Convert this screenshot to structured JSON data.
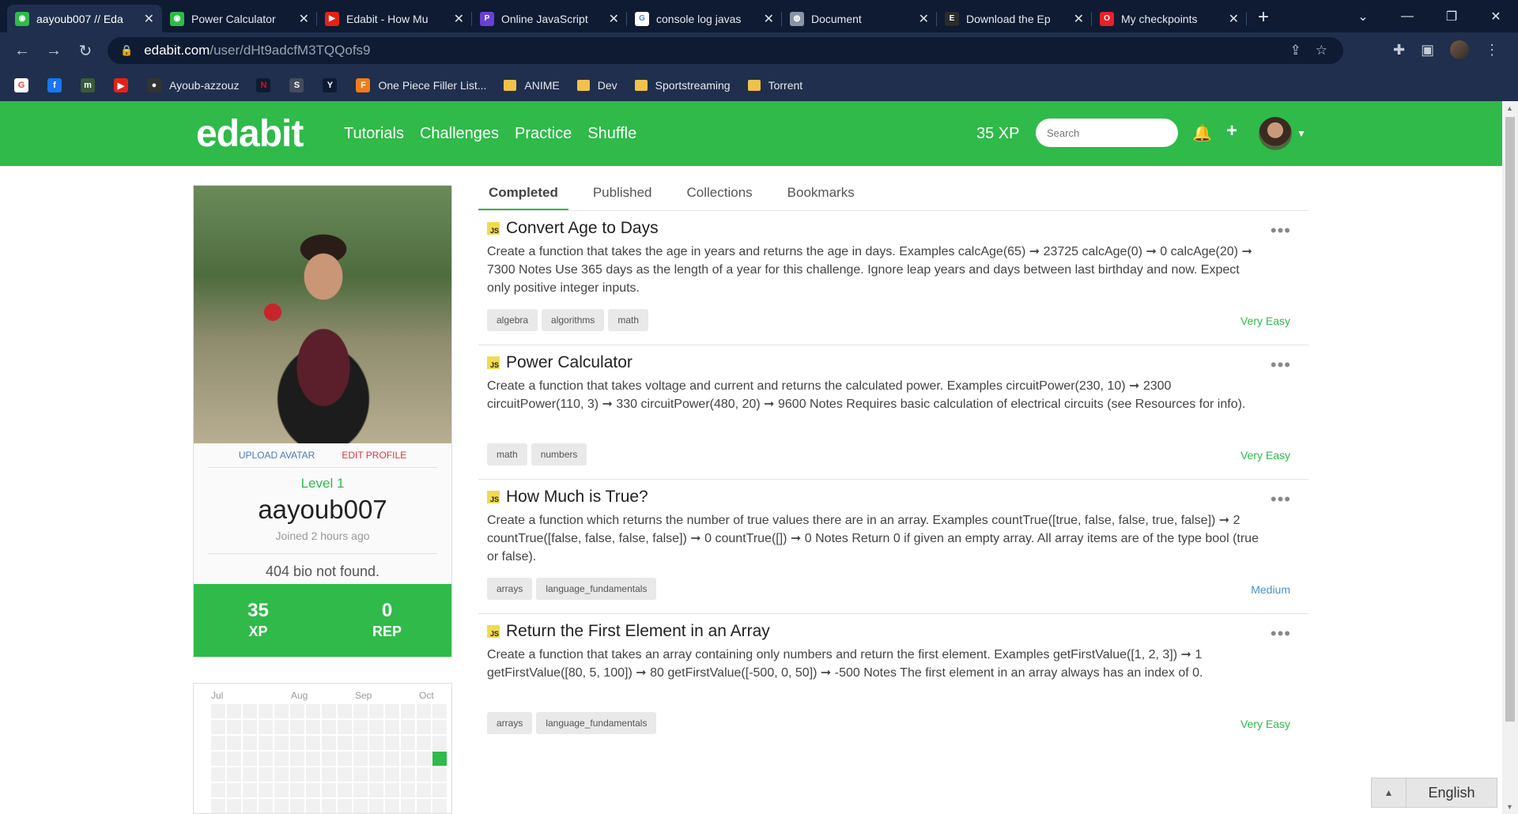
{
  "browser": {
    "tabs": [
      {
        "title": "aayoub007 // Eda",
        "icon": "edabit-favicon",
        "color": "#2fba4a",
        "glyph": "◉",
        "active": true
      },
      {
        "title": "Power Calculator",
        "icon": "edabit-favicon",
        "color": "#2fba4a",
        "glyph": "◉",
        "active": false
      },
      {
        "title": "Edabit - How Mu",
        "icon": "youtube-favicon",
        "color": "#e62117",
        "glyph": "▶",
        "active": false
      },
      {
        "title": "Online JavaScript",
        "icon": "playcode-favicon",
        "color": "#6b3fd8",
        "glyph": "P",
        "active": false
      },
      {
        "title": "console log javas",
        "icon": "google-favicon",
        "color": "#ffffff",
        "glyph": "G",
        "active": false
      },
      {
        "title": "Document",
        "icon": "globe-favicon",
        "color": "#8a94a6",
        "glyph": "◍",
        "active": false
      },
      {
        "title": "Download the Ep",
        "icon": "epic-favicon",
        "color": "#2b2b2b",
        "glyph": "E",
        "active": false
      },
      {
        "title": "My checkpoints",
        "icon": "opera-favicon",
        "color": "#e8202a",
        "glyph": "O",
        "active": false
      }
    ],
    "url_host": "edabit.com",
    "url_path": "/user/dHt9adcfM3TQQofs9",
    "bookmarks": [
      {
        "label": "",
        "icon": "google-icon",
        "color": "#ffffff",
        "glyph": "G"
      },
      {
        "label": "",
        "icon": "facebook-icon",
        "color": "#1877f2",
        "glyph": "f"
      },
      {
        "label": "",
        "icon": "extension-icon",
        "color": "#3a5a3a",
        "glyph": "m"
      },
      {
        "label": "",
        "icon": "youtube-icon",
        "color": "#e62117",
        "glyph": "▶"
      },
      {
        "label": "Ayoub-azzouz",
        "icon": "github-icon",
        "color": "#333333",
        "glyph": "●"
      },
      {
        "label": "",
        "icon": "netflix-icon",
        "color": "#0e1b33",
        "glyph": "N"
      },
      {
        "label": "",
        "icon": "s-icon",
        "color": "#444c5c",
        "glyph": "S"
      },
      {
        "label": "",
        "icon": "yts-icon",
        "color": "#0e1b33",
        "glyph": "Y"
      },
      {
        "label": "One Piece Filler List...",
        "icon": "onepiece-icon",
        "color": "#f07b1a",
        "glyph": "F"
      },
      {
        "label": "ANIME",
        "icon": "folder-icon",
        "folder": true
      },
      {
        "label": "Dev",
        "icon": "folder-icon",
        "folder": true
      },
      {
        "label": "Sportstreaming",
        "icon": "folder-icon",
        "folder": true
      },
      {
        "label": "Torrent",
        "icon": "folder-icon",
        "folder": true
      }
    ]
  },
  "header": {
    "logo": "edabit",
    "nav": [
      "Tutorials",
      "Challenges",
      "Practice",
      "Shuffle"
    ],
    "xp": "35 XP",
    "search_placeholder": "Search"
  },
  "profile": {
    "upload_avatar": "UPLOAD AVATAR",
    "edit_profile": "EDIT PROFILE",
    "level": "Level 1",
    "username": "aayoub007",
    "joined": "Joined 2 hours ago",
    "bio": "404 bio not found.",
    "xp_value": "35",
    "xp_label": "XP",
    "rep_value": "0",
    "rep_label": "REP"
  },
  "activity": {
    "months": [
      "Jul",
      "Aug",
      "Sep",
      "Oct"
    ]
  },
  "tabs": [
    "Completed",
    "Published",
    "Collections",
    "Bookmarks"
  ],
  "challenges": [
    {
      "title": "Convert Age to Days",
      "description": "Create a function that takes the age in years and returns the age in days. Examples calcAge(65) ➞ 23725 calcAge(0) ➞ 0 calcAge(20) ➞ 7300 Notes Use 365 days as the length of a year for this challenge. Ignore leap years and days between last birthday and now. Expect only positive integer inputs.",
      "tags": [
        "algebra",
        "algorithms",
        "math"
      ],
      "difficulty": "Very Easy"
    },
    {
      "title": "Power Calculator",
      "description": "Create a function that takes voltage and current and returns the calculated power. Examples circuitPower(230, 10) ➞ 2300 circuitPower(110, 3) ➞ 330 circuitPower(480, 20) ➞ 9600 Notes Requires basic calculation of electrical circuits (see Resources for info).",
      "tags": [
        "math",
        "numbers"
      ],
      "difficulty": "Very Easy"
    },
    {
      "title": "How Much is True?",
      "description": "Create a function which returns the number of true values there are in an array. Examples countTrue([true, false, false, true, false]) ➞ 2 countTrue([false, false, false, false]) ➞ 0 countTrue([]) ➞ 0 Notes Return 0 if given an empty array. All array items are of the type bool (true or false).",
      "tags": [
        "arrays",
        "language_fundamentals"
      ],
      "difficulty": "Medium"
    },
    {
      "title": "Return the First Element in an Array",
      "description": "Create a function that takes an array containing only numbers and return the first element. Examples getFirstValue([1, 2, 3]) ➞ 1 getFirstValue([80, 5, 100]) ➞ 80 getFirstValue([-500, 0, 50]) ➞ -500 Notes The first element in an array always has an index of 0.",
      "tags": [
        "arrays",
        "language_fundamentals"
      ],
      "difficulty": "Very Easy"
    }
  ],
  "language": "English"
}
